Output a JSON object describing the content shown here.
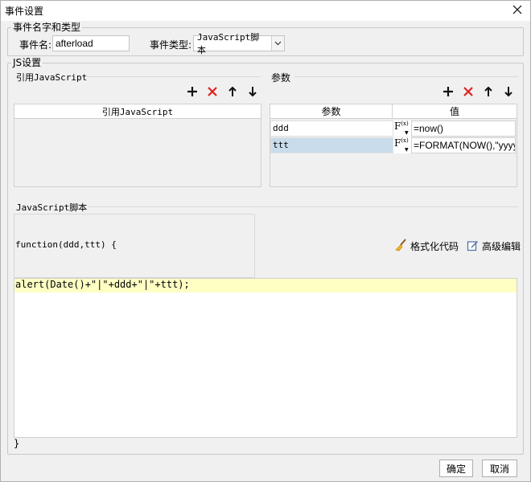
{
  "window": {
    "title": "事件设置",
    "close_icon": "close-icon"
  },
  "event_group": {
    "legend": "事件名字和类型",
    "name_label": "事件名:",
    "name_value": "afterload",
    "type_label": "事件类型:",
    "type_value": "JavaScript脚本"
  },
  "js_group": {
    "legend": "JS设置",
    "ref_section": {
      "title": "引用JavaScript",
      "column": "引用JavaScript",
      "toolbar": [
        "plus-icon",
        "delete-icon",
        "arrow-up-icon",
        "arrow-down-icon"
      ]
    },
    "param_section": {
      "title": "参数",
      "columns": [
        "参数",
        "值"
      ],
      "rows": [
        {
          "name": "ddd",
          "fx": "F(x)",
          "value": "=now()"
        },
        {
          "name": "ttt",
          "fx": "F(x)",
          "value": "=FORMAT(NOW(),\"yyyy"
        }
      ],
      "toolbar": [
        "plus-icon",
        "delete-icon",
        "arrow-up-icon",
        "arrow-down-icon"
      ]
    },
    "script_section": {
      "title": "JavaScript脚本",
      "signature": "function(ddd,ttt) {",
      "body_line": "alert(Date()+\"|\"+ddd+\"|\"+ttt);",
      "closing": "}",
      "format_label": "格式化代码",
      "advanced_label": "高级编辑"
    }
  },
  "footer": {
    "ok_label": "确定",
    "cancel_label": "取消"
  },
  "colors": {
    "delete": "#e02020",
    "highlight_line": "#ffffc4",
    "selected_row": "#c8dceb"
  }
}
